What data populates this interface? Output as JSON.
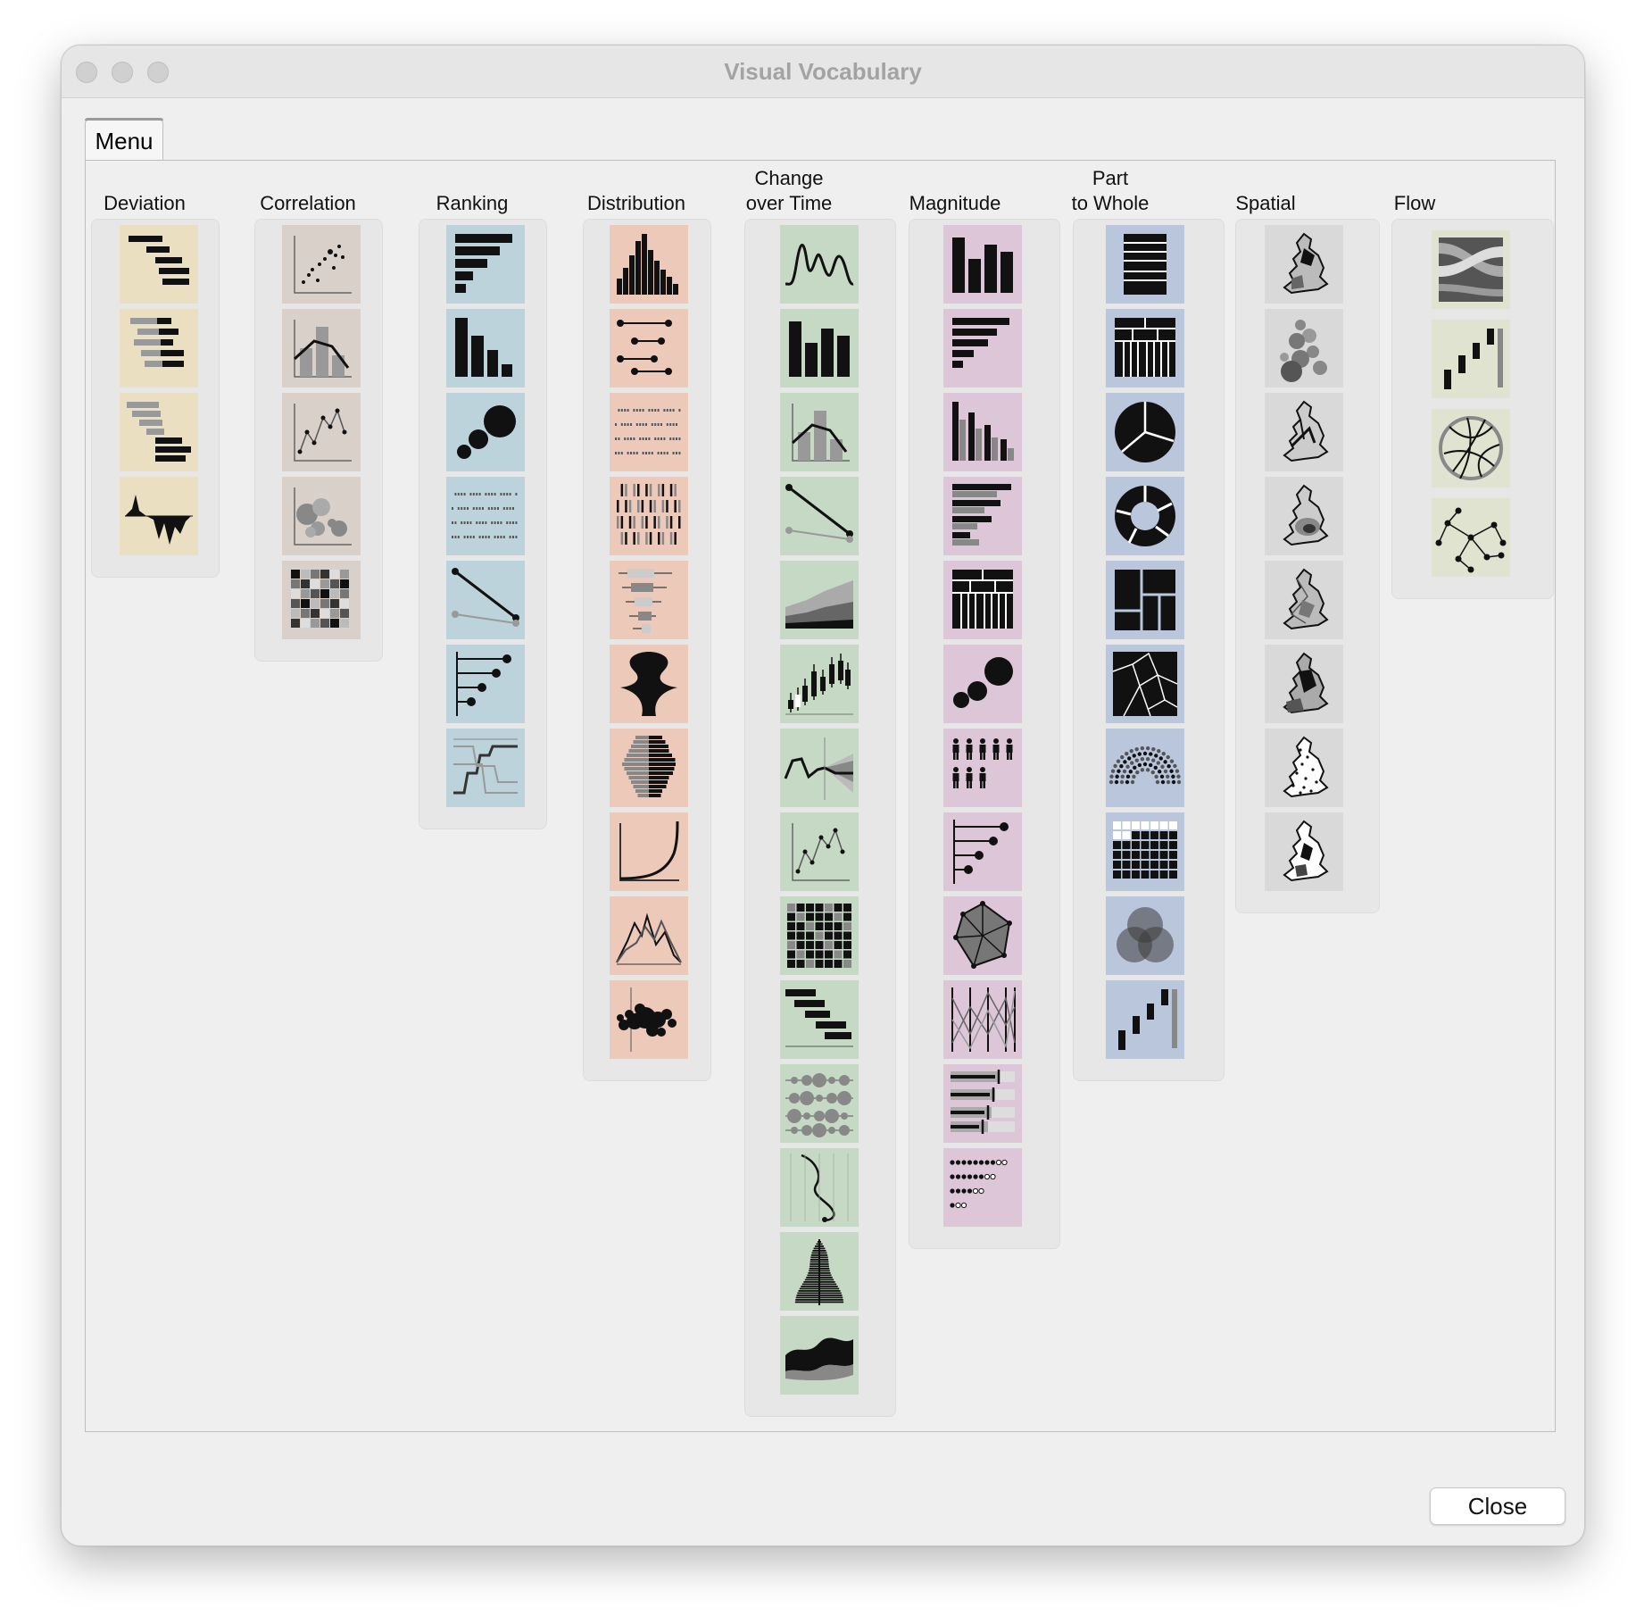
{
  "window": {
    "title": "Visual Vocabulary"
  },
  "tabs": [
    {
      "label": "Menu"
    }
  ],
  "categories": [
    {
      "label": "Deviation",
      "color": "#ebdfc2",
      "items": [
        "diverging-bar-icon",
        "diverging-stacked-bar-icon",
        "spine-chart-icon",
        "surplus-deficit-line-icon"
      ]
    },
    {
      "label": "Correlation",
      "color": "#d8d0c9",
      "items": [
        "scatterplot-icon",
        "column-line-timeline-icon",
        "connected-scatterplot-icon",
        "bubble-chart-icon",
        "xy-heatmap-icon"
      ]
    },
    {
      "label": "Ranking",
      "color": "#bdd3dc",
      "items": [
        "ordered-bar-icon",
        "ordered-column-icon",
        "ordered-proportional-symbol-icon",
        "dot-strip-plot-icon",
        "slope-icon",
        "lollipop-icon",
        "bump-icon"
      ]
    },
    {
      "label": "Distribution",
      "color": "#ecc9b9",
      "items": [
        "histogram-icon",
        "dot-plot-icon",
        "dot-strip-plot-icon",
        "barcode-plot-icon",
        "boxplot-icon",
        "violin-plot-icon",
        "population-pyramid-icon",
        "cumulative-curve-icon",
        "frequency-polygons-icon",
        "beeswarm-icon"
      ]
    },
    {
      "label": "Change\nover Time",
      "color": "#c6d9c5",
      "items": [
        "line-icon",
        "column-icon",
        "column-line-timeline-icon",
        "slope-icon",
        "area-chart-icon",
        "candlestick-icon",
        "fan-chart-icon",
        "connected-scatterplot-icon",
        "calendar-heatmap-icon",
        "priestley-timeline-icon",
        "circle-timeline-icon",
        "vertical-timeline-icon",
        "seismogram-icon",
        "streamgraph-icon"
      ]
    },
    {
      "label": "Magnitude",
      "color": "#dcc6d8",
      "items": [
        "column-icon",
        "bar-icon",
        "paired-column-icon",
        "paired-bar-icon",
        "marimekko-icon",
        "proportional-symbol-icon",
        "isotype-icon",
        "lollipop-icon",
        "radar-chart-icon",
        "parallel-coordinates-icon",
        "bullet-icon",
        "grouped-symbol-icon"
      ]
    },
    {
      "label": "Part\nto Whole",
      "color": "#bac6dc",
      "items": [
        "stacked-column-icon",
        "marimekko-icon",
        "pie-icon",
        "donut-icon",
        "treemap-icon",
        "voronoi-icon",
        "arc-icon",
        "gridplot-icon",
        "venn-icon",
        "waterfall-icon"
      ]
    },
    {
      "label": "Spatial",
      "color": "#d9d9d9",
      "items": [
        "basic-choropleth-icon",
        "proportional-symbol-map-icon",
        "flow-map-icon",
        "contour-map-icon",
        "equalised-cartogram-icon",
        "scaled-cartogram-icon",
        "dot-density-icon",
        "heat-map-icon"
      ]
    },
    {
      "label": "Flow",
      "color": "#dfe3cf",
      "items": [
        "sankey-icon",
        "waterfall-icon",
        "chord-icon",
        "network-icon"
      ]
    }
  ],
  "buttons": {
    "close": "Close"
  }
}
